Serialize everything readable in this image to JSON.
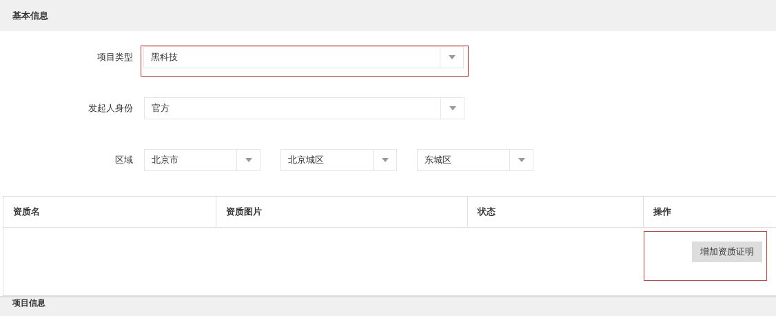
{
  "section_title": "基本信息",
  "form": [
    {
      "label": "项目类型",
      "selects": [
        {
          "value": "黑科技"
        }
      ],
      "highlighted": true
    },
    {
      "label": "发起人身份",
      "selects": [
        {
          "value": "官方"
        }
      ],
      "highlighted": false
    },
    {
      "label": "区域",
      "selects": [
        {
          "value": "北京市"
        },
        {
          "value": "北京城区"
        },
        {
          "value": "东城区"
        }
      ],
      "highlighted": false
    }
  ],
  "table": {
    "columns": [
      "资质名",
      "资质图片",
      "状态",
      "操作"
    ],
    "add_button": {
      "label": "增加资质证明",
      "highlighted": true
    }
  },
  "next_section_title": "项目信息"
}
